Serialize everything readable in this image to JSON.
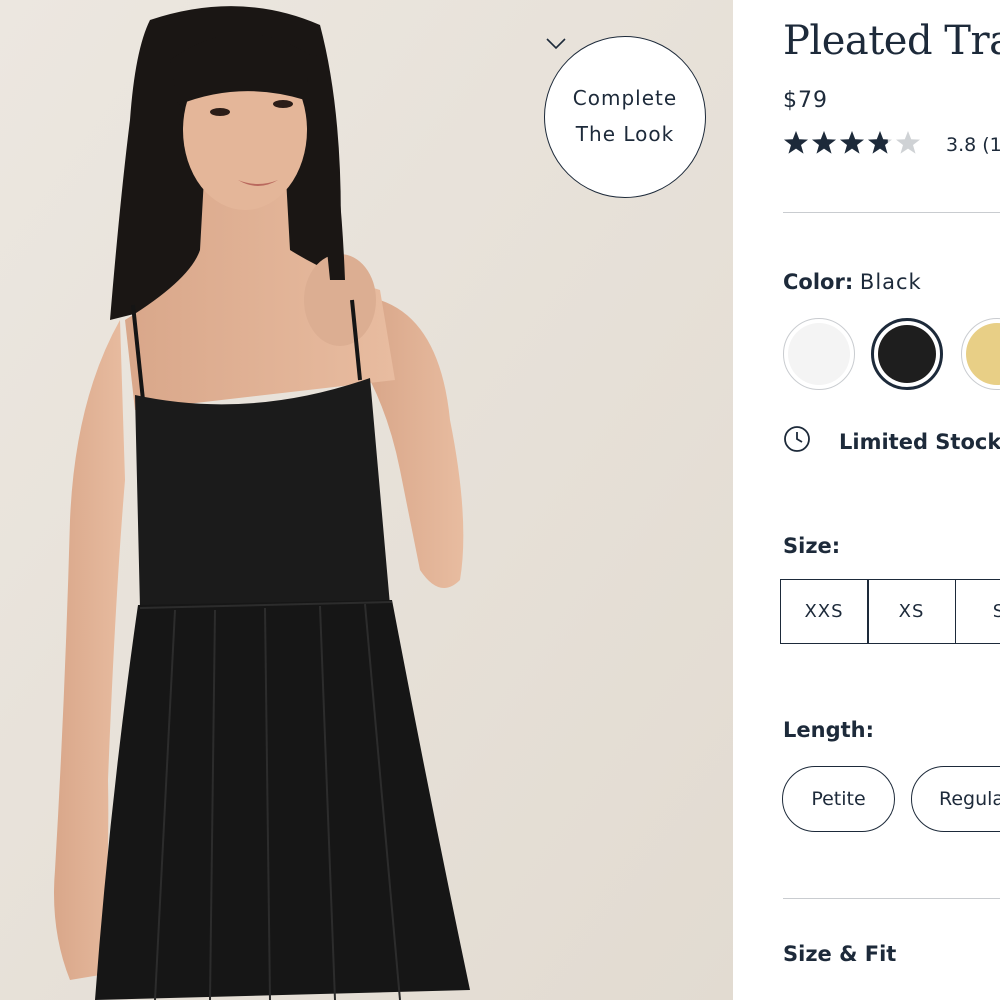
{
  "product": {
    "title": "Pleated Trave",
    "price": "$79",
    "rating": {
      "value": 3.8,
      "display": "3.8 (1",
      "max_stars": 5
    }
  },
  "complete_the_look": {
    "line1": "Complete",
    "line2": "The Look",
    "icon": "chevron-down-icon"
  },
  "color": {
    "label": "Color:",
    "selected": "Black",
    "swatches": [
      {
        "name": "white-swatch",
        "color": "#f4f4f4",
        "selected": false
      },
      {
        "name": "black-swatch",
        "color": "#1e1e1e",
        "selected": true
      },
      {
        "name": "yellow-swatch",
        "color": "#e8cf86",
        "selected": false
      }
    ]
  },
  "stock": {
    "icon": "clock-icon",
    "text": "Limited Stock"
  },
  "size": {
    "label": "Size:",
    "options": [
      "XXS",
      "XS",
      "S"
    ]
  },
  "length": {
    "label": "Length:",
    "options": [
      "Petite",
      "Regula"
    ]
  },
  "size_fit": {
    "label": "Size & Fit"
  },
  "colors": {
    "text": "#1d2a3a",
    "photo_bg": "#e7e1d9",
    "divider": "#c9ccd0",
    "star_empty": "#cfd2d5"
  }
}
